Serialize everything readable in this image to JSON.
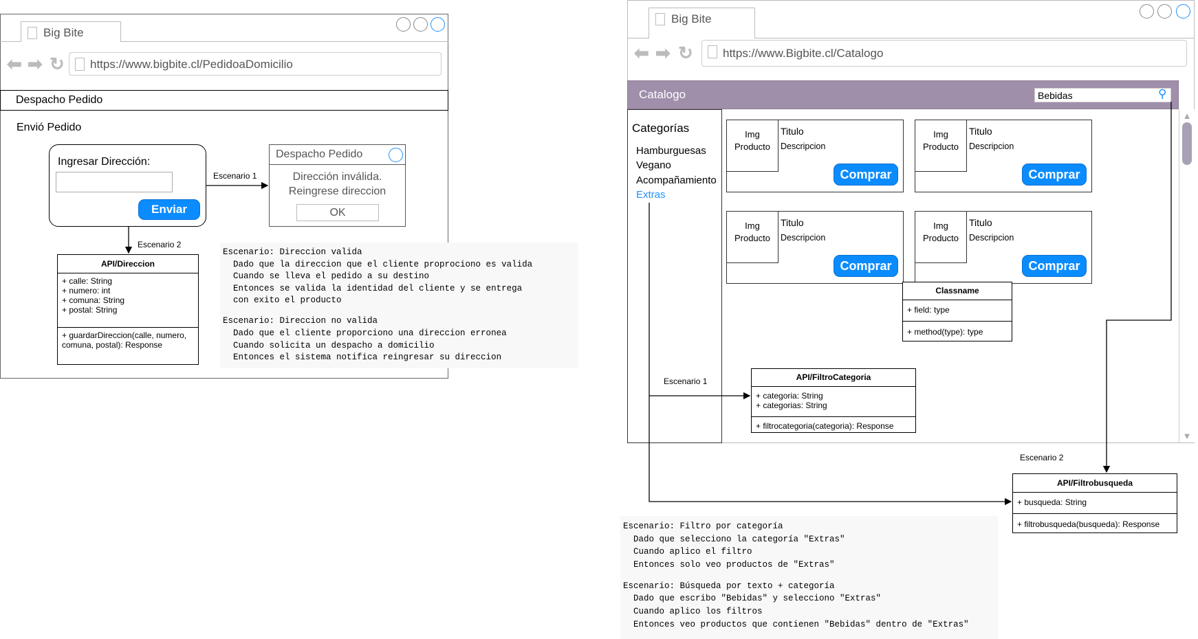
{
  "left_window": {
    "tab_title": "Big Bite",
    "url": "https://www.bigbite.cl/PedidoaDomicilio",
    "header": "Despacho Pedido",
    "section_title": "Envió Pedido",
    "form": {
      "label": "Ingresar Dirección:",
      "input_value": "",
      "submit_label": "Enviar"
    },
    "dialog": {
      "title": "Despacho Pedido",
      "message_line1": "Dirección inválida.",
      "message_line2": "Reingrese direccion",
      "ok_label": "OK"
    },
    "edge_labels": {
      "scenario1": "Escenario 1",
      "scenario2": "Escenario 2"
    },
    "api_class": {
      "name": "API/Direccion",
      "attributes": [
        "+ calle: String",
        "+ numero: int",
        "+ comuna: String",
        "+ postal: String"
      ],
      "methods": [
        "+ guardarDireccion(calle, numero,",
        "comuna, postal): Response"
      ]
    },
    "gherkin": [
      "Escenario: Direccion valida",
      "  Dado que la direccion que el cliente proprociono es valida",
      "  Cuando se lleva el pedido a su destino",
      "  Entonces se valida la identidad del cliente y se entrega",
      "  con exito el producto",
      "",
      "Escenario: Direccion no valida",
      "  Dado que el cliente proporciono una direccion erronea",
      "  Cuando solicita un despacho a domicilio",
      "  Entonces el sistema notifica reingresar su direccion"
    ]
  },
  "right_window": {
    "tab_title": "Big Bite",
    "url": "https://www.Bigbite.cl/Catalogo",
    "header": "Catalogo",
    "search_value": "Bebidas",
    "sidebar": {
      "title": "Categorías",
      "items": [
        "Hamburguesas",
        "Vegano",
        "Acompañamiento",
        "Extras"
      ],
      "active": "Extras"
    },
    "products": [
      {
        "img": "Img Producto",
        "title": "Titulo",
        "desc": "Descripcion",
        "button": "Comprar"
      },
      {
        "img": "Img Producto",
        "title": "Titulo",
        "desc": "Descripcion",
        "button": "Comprar"
      },
      {
        "img": "Img Producto",
        "title": "Titulo",
        "desc": "Descripcion",
        "button": "Comprar"
      },
      {
        "img": "Img Producto",
        "title": "Titulo",
        "desc": "Descripcion",
        "button": "Comprar"
      }
    ],
    "placeholder_class": {
      "name": "Classname",
      "field": "+ field: type",
      "method": "+ method(type): type"
    },
    "api_categoria": {
      "name": "API/FiltroCategoria",
      "attributes": [
        "+ categoria: String",
        "+ categorias: String"
      ],
      "method": "+ filtrocategoria(categoria): Response"
    },
    "api_busqueda": {
      "name": "API/Filtrobusqueda",
      "attribute": "+ busqueda: String",
      "method": "+ filtrobusqueda(busqueda): Response"
    },
    "edge_labels": {
      "scenario1": "Escenario 1",
      "scenario2": "Escenario 2"
    },
    "gherkin": [
      "Escenario: Filtro por categoría",
      "  Dado que selecciono la categoría \"Extras\"",
      "  Cuando aplico el filtro",
      "  Entonces solo veo productos de \"Extras\"",
      "",
      "Escenario: Búsqueda por texto + categoría",
      "  Dado que escribo \"Bebidas\" y selecciono \"Extras\"",
      "  Cuando aplico los filtros",
      "  Entonces veo productos que contienen \"Bebidas\" dentro de \"Extras\""
    ]
  },
  "colors": {
    "accent": "#0a8cff",
    "catalog_bar": "#a08fab"
  }
}
